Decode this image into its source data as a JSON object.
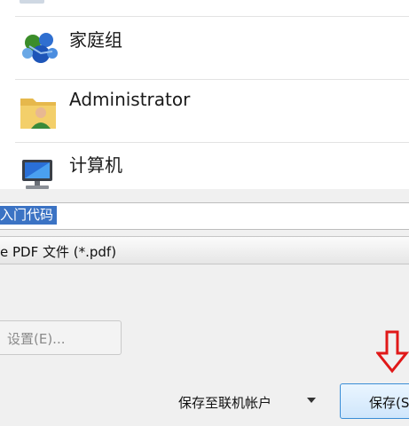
{
  "nav": {
    "items": [
      {
        "label": "家庭组",
        "icon": "homegroup-icon"
      },
      {
        "label": "Administrator",
        "icon": "user-folder-icon"
      },
      {
        "label": "计算机",
        "icon": "computer-icon"
      }
    ]
  },
  "filename": {
    "value": "入门代码"
  },
  "filetype": {
    "value": "e PDF 文件 (*.pdf)"
  },
  "settings_button": {
    "label": "设置(E)..."
  },
  "save_online": {
    "label": "保存至联机帐户"
  },
  "save_button": {
    "label": "保存(S"
  },
  "annotation": {
    "icon": "red-down-arrow-icon",
    "color": "#e01818"
  }
}
